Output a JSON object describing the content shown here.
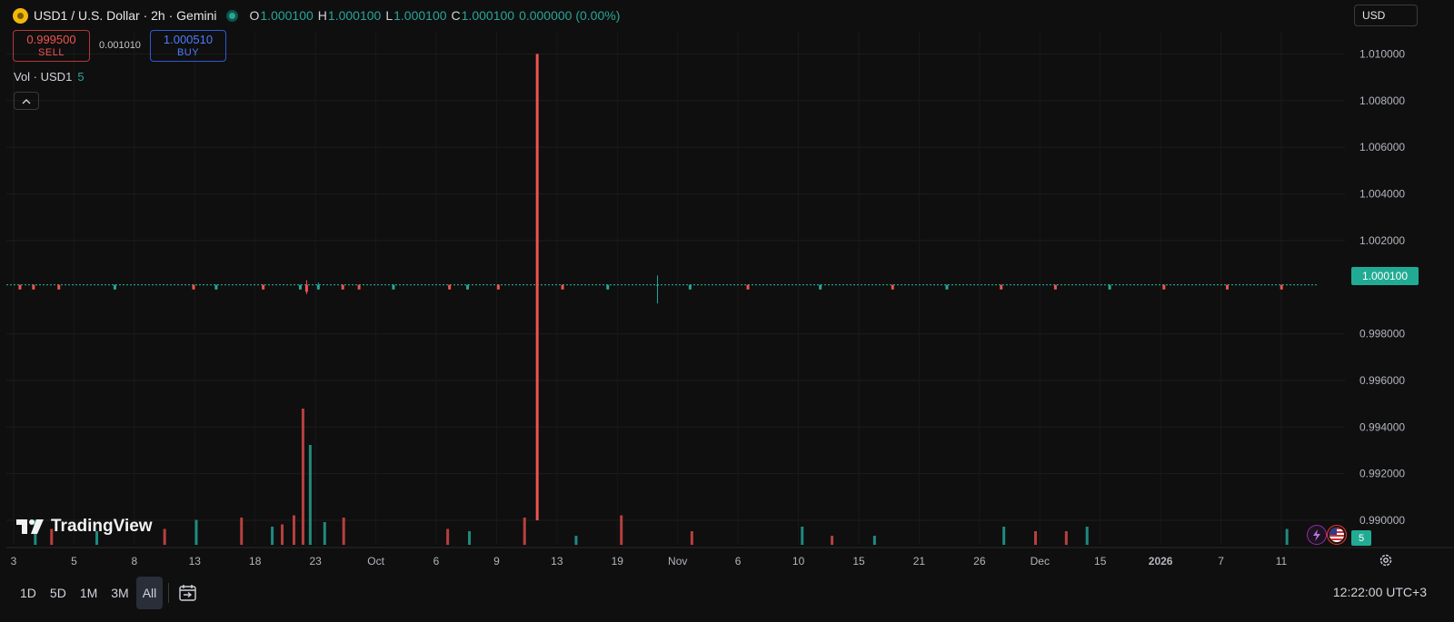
{
  "header": {
    "title": "USD1 / U.S. Dollar · 2h · Gemini",
    "ohlc": [
      {
        "key": "O",
        "value": "1.000100"
      },
      {
        "key": "H",
        "value": "1.000100"
      },
      {
        "key": "L",
        "value": "1.000100"
      },
      {
        "key": "C",
        "value": "1.000100"
      }
    ],
    "change": "0.000000 (0.00%)"
  },
  "trade": {
    "sell_price": "0.999500",
    "sell_label": "SELL",
    "spread": "0.001010",
    "buy_price": "1.000510",
    "buy_label": "BUY"
  },
  "volume": {
    "label": "Vol · USD1",
    "value": "5",
    "collapse_glyph": "^"
  },
  "currency_selector": "USD",
  "last_price_label": "1.000100",
  "volume_tag": "5",
  "branding": "TradingView",
  "bottom_bar": {
    "ranges": [
      "1D",
      "5D",
      "1M",
      "3M",
      "All"
    ],
    "active_range": "All",
    "clock": "12:22:00 UTC+3"
  },
  "colors": {
    "up": "#26a69a",
    "down": "#ef5350",
    "background": "#0f0f0f",
    "last_price_tag": "#22ab94"
  },
  "chart_data": {
    "type": "candlestick",
    "interval": "2h",
    "grid": true,
    "y_axis": {
      "side": "right",
      "range": [
        0.98895,
        1.01095
      ],
      "ticks": [
        "1.010000",
        "1.008000",
        "1.006000",
        "1.004000",
        "1.002000",
        "0.998000",
        "0.996000",
        "0.994000",
        "0.992000",
        "0.990000"
      ]
    },
    "x_axis": {
      "ticks": [
        "3",
        "5",
        "8",
        "13",
        "18",
        "23",
        "Oct",
        "6",
        "9",
        "13",
        "19",
        "Nov",
        "6",
        "10",
        "15",
        "21",
        "26",
        "Dec",
        "15",
        "2026",
        "7",
        "11"
      ],
      "bold_ticks": [
        "2026"
      ]
    },
    "last_price": 1.0001,
    "baseline_price": 1.0001,
    "candles": [
      {
        "pos": 0.015,
        "open": 1.0001,
        "close": 0.9999,
        "high": 1.0001,
        "low": 0.9999
      },
      {
        "pos": 0.03,
        "open": 1.0001,
        "close": 0.9999,
        "high": 1.0001,
        "low": 0.9999
      },
      {
        "pos": 0.058,
        "open": 1.0001,
        "close": 0.9999,
        "high": 1.0001,
        "low": 0.9999
      },
      {
        "pos": 0.12,
        "open": 0.9999,
        "close": 1.0001,
        "high": 1.0001,
        "low": 0.9999
      },
      {
        "pos": 0.207,
        "open": 1.0001,
        "close": 0.9999,
        "high": 1.0001,
        "low": 0.9999
      },
      {
        "pos": 0.232,
        "open": 0.9999,
        "close": 1.0001,
        "high": 1.0001,
        "low": 0.9999
      },
      {
        "pos": 0.284,
        "open": 1.0001,
        "close": 0.9999,
        "high": 1.0001,
        "low": 0.9999
      },
      {
        "pos": 0.325,
        "open": 0.9999,
        "close": 1.0001,
        "high": 1.0001,
        "low": 0.9999
      },
      {
        "pos": 0.332,
        "open": 1.0001,
        "close": 0.9998,
        "high": 1.0003,
        "low": 0.9997
      },
      {
        "pos": 0.345,
        "open": 0.9999,
        "close": 1.0001,
        "high": 1.0002,
        "low": 0.9999
      },
      {
        "pos": 0.372,
        "open": 1.0001,
        "close": 0.9999,
        "high": 1.0001,
        "low": 0.9999
      },
      {
        "pos": 0.39,
        "open": 1.0001,
        "close": 0.9999,
        "high": 1.0001,
        "low": 0.9999
      },
      {
        "pos": 0.428,
        "open": 0.9999,
        "close": 1.0001,
        "high": 1.0001,
        "low": 0.9999
      },
      {
        "pos": 0.49,
        "open": 1.0001,
        "close": 0.9999,
        "high": 1.0001,
        "low": 0.9999
      },
      {
        "pos": 0.51,
        "open": 0.9999,
        "close": 1.0001,
        "high": 1.0001,
        "low": 0.9999
      },
      {
        "pos": 0.544,
        "open": 1.0001,
        "close": 0.9999,
        "high": 1.0001,
        "low": 0.9999
      },
      {
        "pos": 0.587,
        "open": 1.01,
        "close": 0.99,
        "high": 1.01,
        "low": 0.99
      },
      {
        "pos": 0.615,
        "open": 1.0001,
        "close": 0.9999,
        "high": 1.0001,
        "low": 0.9999
      },
      {
        "pos": 0.665,
        "open": 0.9999,
        "close": 1.0001,
        "high": 1.0001,
        "low": 0.9999
      },
      {
        "pos": 0.72,
        "open": 1.0001,
        "close": 1.0001,
        "high": 1.0005,
        "low": 0.9993
      },
      {
        "pos": 0.756,
        "open": 0.9999,
        "close": 1.0001,
        "high": 1.0001,
        "low": 0.9999
      },
      {
        "pos": 0.82,
        "open": 1.0001,
        "close": 0.9999,
        "high": 1.0001,
        "low": 0.9999
      },
      {
        "pos": 0.9,
        "open": 0.9999,
        "close": 1.0001,
        "high": 1.0001,
        "low": 0.9999
      },
      {
        "pos": 0.98,
        "open": 1.0001,
        "close": 0.9999,
        "high": 1.0001,
        "low": 0.9999
      },
      {
        "pos": 1.04,
        "open": 0.9999,
        "close": 1.0001,
        "high": 1.0001,
        "low": 0.9999
      },
      {
        "pos": 1.1,
        "open": 1.0001,
        "close": 0.9999,
        "high": 1.0001,
        "low": 0.9999
      },
      {
        "pos": 1.16,
        "open": 1.0001,
        "close": 0.9999,
        "high": 1.0001,
        "low": 0.9999
      },
      {
        "pos": 1.22,
        "open": 0.9999,
        "close": 1.0001,
        "high": 1.0001,
        "low": 0.9999
      },
      {
        "pos": 1.28,
        "open": 1.0001,
        "close": 0.9999,
        "high": 1.0001,
        "low": 0.9999
      },
      {
        "pos": 1.35,
        "open": 1.0001,
        "close": 0.9999,
        "high": 1.0001,
        "low": 0.9999
      },
      {
        "pos": 1.41,
        "open": 1.0001,
        "close": 0.9999,
        "high": 1.0001,
        "low": 0.9999
      }
    ],
    "volume_bars": [
      {
        "pos": 0.032,
        "value": 0.55,
        "dir": "up"
      },
      {
        "pos": 0.05,
        "value": 0.35,
        "dir": "down"
      },
      {
        "pos": 0.1,
        "value": 0.3,
        "dir": "up"
      },
      {
        "pos": 0.175,
        "value": 0.35,
        "dir": "down"
      },
      {
        "pos": 0.21,
        "value": 0.55,
        "dir": "up"
      },
      {
        "pos": 0.26,
        "value": 0.6,
        "dir": "down"
      },
      {
        "pos": 0.294,
        "value": 0.4,
        "dir": "up"
      },
      {
        "pos": 0.305,
        "value": 0.45,
        "dir": "down"
      },
      {
        "pos": 0.318,
        "value": 0.65,
        "dir": "down"
      },
      {
        "pos": 0.328,
        "value": 3.0,
        "dir": "down"
      },
      {
        "pos": 0.336,
        "value": 2.2,
        "dir": "up"
      },
      {
        "pos": 0.352,
        "value": 0.5,
        "dir": "up"
      },
      {
        "pos": 0.373,
        "value": 0.6,
        "dir": "down"
      },
      {
        "pos": 0.488,
        "value": 0.35,
        "dir": "down"
      },
      {
        "pos": 0.512,
        "value": 0.3,
        "dir": "up"
      },
      {
        "pos": 0.573,
        "value": 0.6,
        "dir": "down"
      },
      {
        "pos": 0.63,
        "value": 0.2,
        "dir": "up"
      },
      {
        "pos": 0.68,
        "value": 0.65,
        "dir": "down"
      },
      {
        "pos": 0.758,
        "value": 0.3,
        "dir": "down"
      },
      {
        "pos": 0.88,
        "value": 0.4,
        "dir": "up"
      },
      {
        "pos": 0.913,
        "value": 0.2,
        "dir": "down"
      },
      {
        "pos": 0.96,
        "value": 0.2,
        "dir": "up"
      },
      {
        "pos": 1.103,
        "value": 0.4,
        "dir": "up"
      },
      {
        "pos": 1.138,
        "value": 0.3,
        "dir": "down"
      },
      {
        "pos": 1.172,
        "value": 0.3,
        "dir": "down"
      },
      {
        "pos": 1.195,
        "value": 0.4,
        "dir": "up"
      },
      {
        "pos": 1.416,
        "value": 0.35,
        "dir": "up"
      }
    ]
  }
}
